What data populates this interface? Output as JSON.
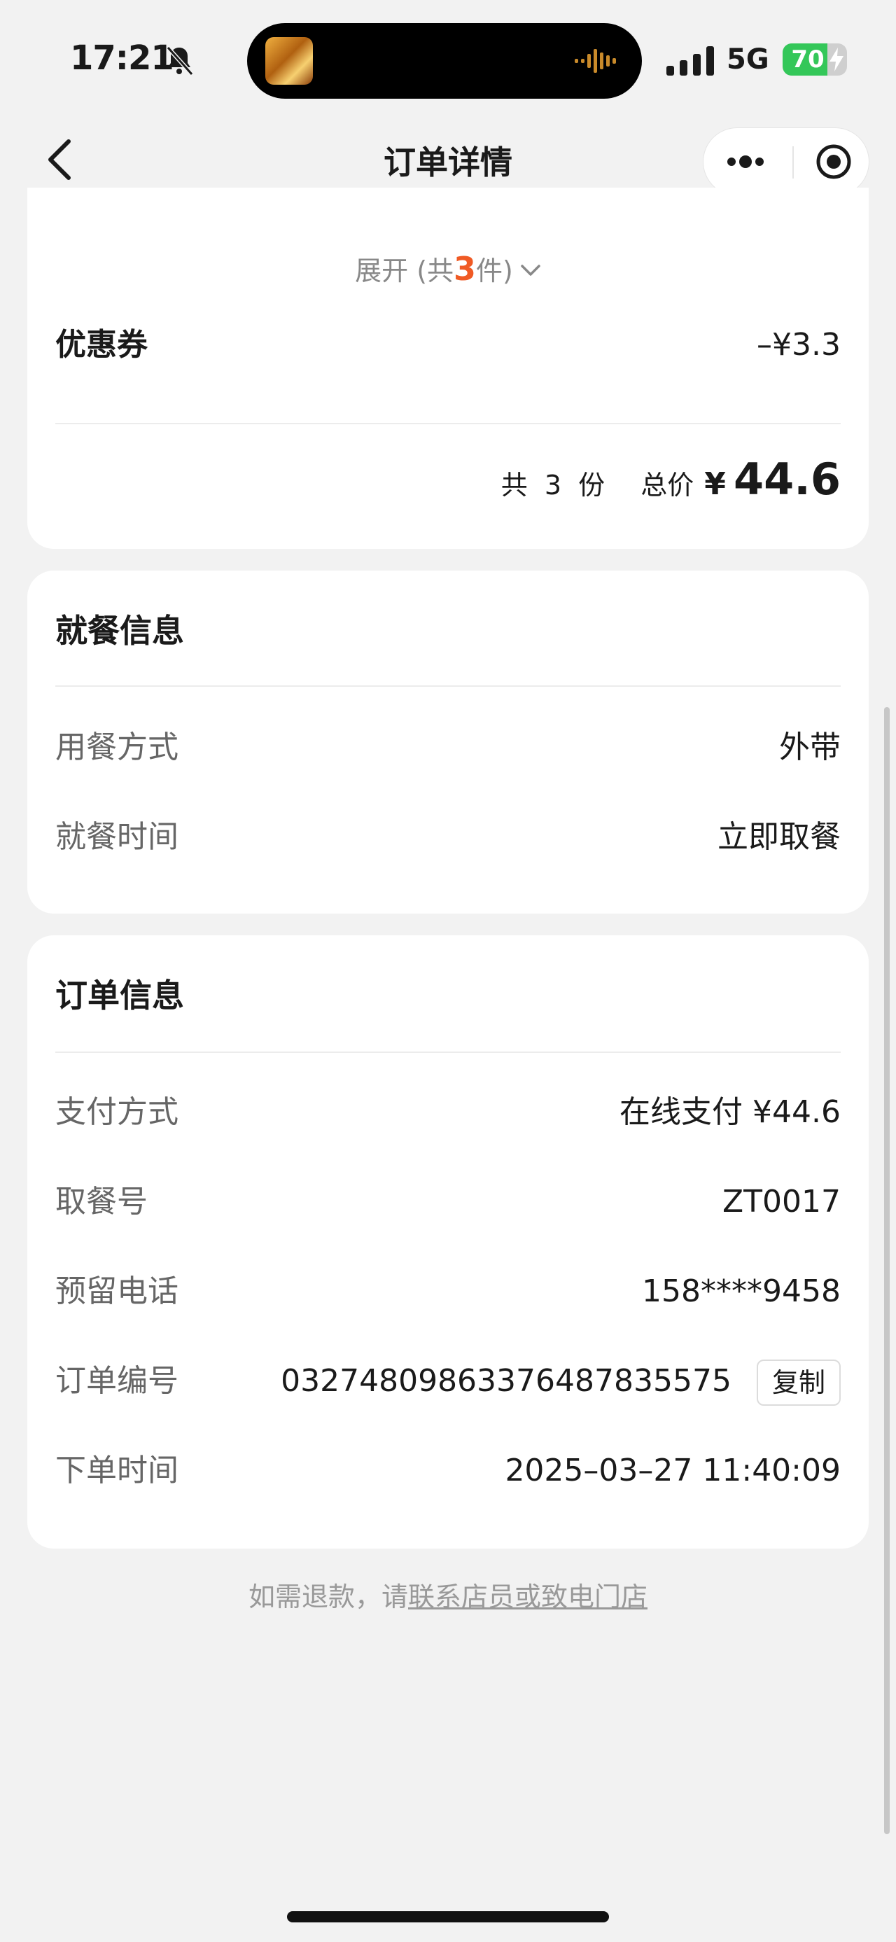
{
  "status_bar": {
    "time": "17:21",
    "network": "5G",
    "battery": "70",
    "battery_level": 0.7
  },
  "nav": {
    "title": "订单详情"
  },
  "items_summary": {
    "expand_prefix": "展开 (共",
    "expand_count": "3",
    "expand_suffix": "件)",
    "coupon_label": "优惠券",
    "coupon_value": "–¥3.3",
    "total_count": "共 3 份",
    "total_label": "总价",
    "total_currency": "¥",
    "total_amount": "44.6"
  },
  "dining_info": {
    "title": "就餐信息",
    "rows": [
      {
        "label": "用餐方式",
        "value": "外带"
      },
      {
        "label": "就餐时间",
        "value": "立即取餐"
      }
    ]
  },
  "order_info": {
    "title": "订单信息",
    "rows": [
      {
        "label": "支付方式",
        "value": "在线支付 ¥44.6"
      },
      {
        "label": "取餐号",
        "value": "ZT0017"
      },
      {
        "label": "预留电话",
        "value": "158****9458"
      },
      {
        "label": "订单编号",
        "value": "03274809863376487835575"
      },
      {
        "label": "下单时间",
        "value": "2025–03–27 11:40:09"
      }
    ],
    "copy_label": "复制"
  },
  "footer": {
    "refund_prefix": "如需退款，请",
    "refund_link": "联系店员或致电门店"
  },
  "colors": {
    "accent": "#f05a24",
    "battery_green": "#34c759",
    "page_bg": "#f2f2f2"
  }
}
